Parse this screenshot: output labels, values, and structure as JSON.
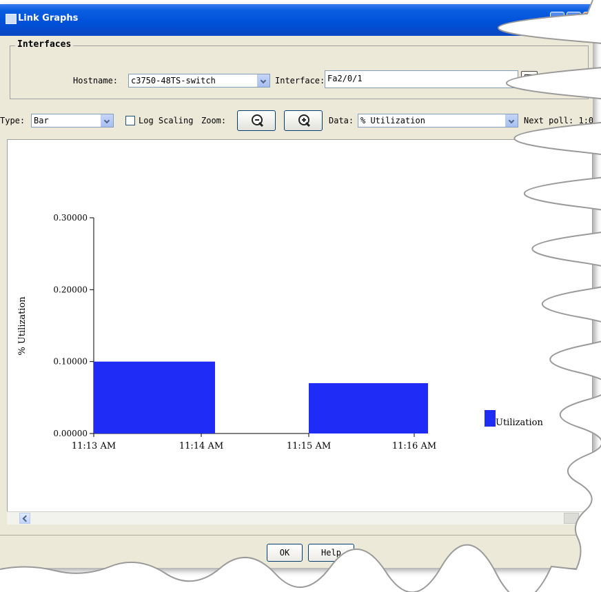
{
  "window": {
    "title": "Link Graphs"
  },
  "interfaces": {
    "group_title": "Interfaces",
    "hostname_label": "Hostname:",
    "hostname_value": "c3750-48TS-switch",
    "interface_label": "Interface:",
    "interface_value": "Fa2/0/1"
  },
  "toolbar": {
    "type_label": "Type:",
    "type_value": "Bar",
    "log_scaling_label": "Log Scaling",
    "log_scaling_checked": false,
    "zoom_label": "Zoom:",
    "data_label": "Data:",
    "data_value": "% Utilization",
    "next_poll_label": "Next poll: 1:0"
  },
  "buttons": {
    "ok": "OK",
    "help": "Help"
  },
  "chart_data": {
    "type": "bar",
    "ylabel": "% Utilization",
    "ylim": [
      0,
      0.3
    ],
    "yticks": [
      "0.00000",
      "0.10000",
      "0.20000",
      "0.30000"
    ],
    "xticks": [
      "11:13 AM",
      "11:14 AM",
      "11:15 AM",
      "11:16 AM"
    ],
    "series": [
      {
        "name": "Utilization",
        "color": "#1f2cf5",
        "bars": [
          {
            "from": "11:13 AM",
            "to": "11:14 AM",
            "value": 0.1
          },
          {
            "from": "11:15 AM",
            "to": "11:16 AM",
            "value": 0.07
          }
        ]
      }
    ],
    "legend_position": "right",
    "grid": false
  }
}
